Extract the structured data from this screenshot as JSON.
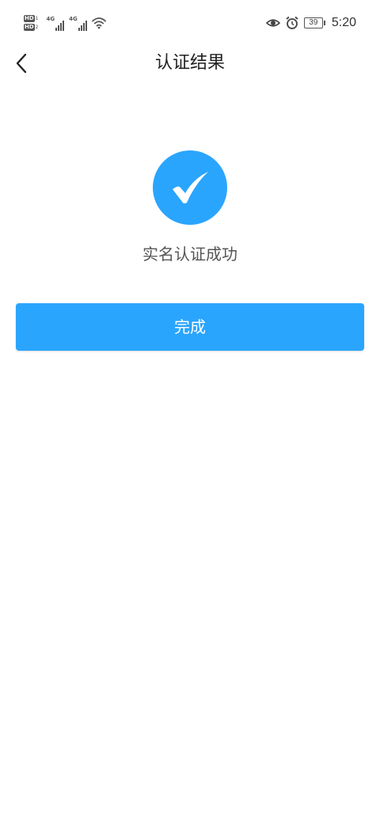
{
  "status_bar": {
    "hd_badge_1": "HD",
    "hd_sub_1": "1",
    "hd_badge_2": "HD",
    "hd_sub_2": "2",
    "network_1": "4G",
    "network_2": "4G",
    "battery": "39",
    "time": "5:20",
    "icons": [
      "hd-icon",
      "signal-icon",
      "wifi-icon",
      "eye-icon",
      "alarm-icon",
      "battery-icon"
    ]
  },
  "header": {
    "title": "认证结果",
    "back_icon": "back-arrow-icon"
  },
  "result": {
    "icon": "check-circle-icon",
    "message": "实名认证成功"
  },
  "actions": {
    "done_label": "完成"
  },
  "colors": {
    "accent": "#2aa5fd",
    "background": "#ffffff",
    "title_text": "#222222",
    "message_text": "#555555"
  }
}
